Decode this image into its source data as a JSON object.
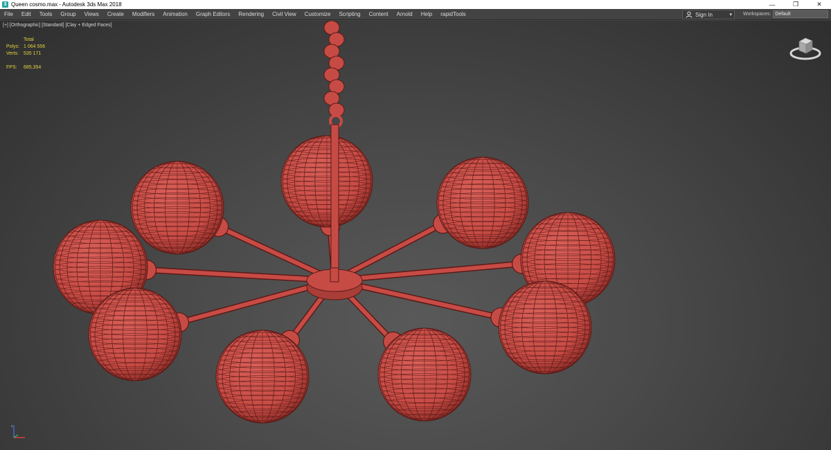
{
  "window": {
    "title": "Queen cosmo.max - Autodesk 3ds Max 2018",
    "app_icon_letter": "3",
    "controls": {
      "minimize": "—",
      "restore": "❐",
      "close": "✕"
    }
  },
  "menubar": {
    "items": [
      "File",
      "Edit",
      "Tools",
      "Group",
      "Views",
      "Create",
      "Modifiers",
      "Animation",
      "Graph Editors",
      "Rendering",
      "Civil View",
      "Customize",
      "Scripting",
      "Content",
      "Arnold",
      "Help",
      "rapidTools"
    ],
    "signin": {
      "label": "Sign In",
      "caret": "▾"
    },
    "workspaces": {
      "label": "Workspaces:",
      "value": "Default"
    }
  },
  "viewport": {
    "label": "[+] [Orthographic] [Standard] [Clay + Edged Faces]",
    "stats": {
      "header": "Total",
      "polys_label": "Polys:",
      "polys_value": "1 064 556",
      "verts_label": "Verts:",
      "verts_value": "535 171",
      "fps_label": "FPS:",
      "fps_value": "685,354"
    },
    "model_color": "#c74b45",
    "wire_color": "#5a1a16",
    "icons": {
      "viewcube": "viewcube-icon",
      "axis": "axis-gizmo-icon"
    }
  }
}
